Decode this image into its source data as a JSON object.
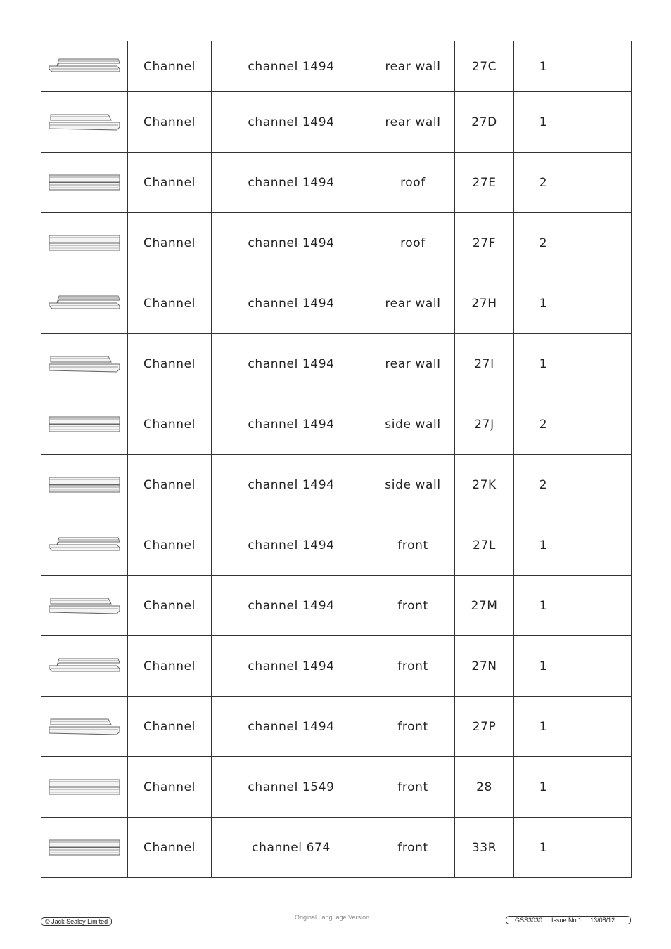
{
  "rows": [
    {
      "thumb": "channel-offset-up-icon",
      "type": "Channel",
      "part": "channel 1494",
      "location": "rear wall",
      "ref": "27C",
      "qty": "1",
      "notes": ""
    },
    {
      "thumb": "channel-offset-down-icon",
      "type": "Channel",
      "part": "channel 1494",
      "location": "rear wall",
      "ref": "27D",
      "qty": "1",
      "notes": ""
    },
    {
      "thumb": "channel-stacked-icon",
      "type": "Channel",
      "part": "channel 1494",
      "location": "roof",
      "ref": "27E",
      "qty": "2",
      "notes": ""
    },
    {
      "thumb": "channel-stacked-icon",
      "type": "Channel",
      "part": "channel 1494",
      "location": "roof",
      "ref": "27F",
      "qty": "2",
      "notes": ""
    },
    {
      "thumb": "channel-offset-up-icon",
      "type": "Channel",
      "part": "channel 1494",
      "location": "rear wall",
      "ref": "27H",
      "qty": "1",
      "notes": ""
    },
    {
      "thumb": "channel-offset-down-icon",
      "type": "Channel",
      "part": "channel 1494",
      "location": "rear wall",
      "ref": "27I",
      "qty": "1",
      "notes": ""
    },
    {
      "thumb": "channel-stacked-icon",
      "type": "Channel",
      "part": "channel 1494",
      "location": "side wall",
      "ref": "27J",
      "qty": "2",
      "notes": ""
    },
    {
      "thumb": "channel-stacked-icon",
      "type": "Channel",
      "part": "channel 1494",
      "location": "side wall",
      "ref": "27K",
      "qty": "2",
      "notes": ""
    },
    {
      "thumb": "channel-offset-up-icon",
      "type": "Channel",
      "part": "channel 1494",
      "location": "front",
      "ref": "27L",
      "qty": "1",
      "notes": ""
    },
    {
      "thumb": "channel-offset-down-icon",
      "type": "Channel",
      "part": "channel 1494",
      "location": "front",
      "ref": "27M",
      "qty": "1",
      "notes": ""
    },
    {
      "thumb": "channel-offset-up-icon",
      "type": "Channel",
      "part": "channel 1494",
      "location": "front",
      "ref": "27N",
      "qty": "1",
      "notes": ""
    },
    {
      "thumb": "channel-offset-down-icon",
      "type": "Channel",
      "part": "channel 1494",
      "location": "front",
      "ref": "27P",
      "qty": "1",
      "notes": ""
    },
    {
      "thumb": "channel-stacked-icon",
      "type": "Channel",
      "part": "channel 1549",
      "location": "front",
      "ref": "28",
      "qty": "1",
      "notes": ""
    },
    {
      "thumb": "channel-stacked-icon",
      "type": "Channel",
      "part": "channel 674",
      "location": "front",
      "ref": "33R",
      "qty": "1",
      "notes": ""
    }
  ],
  "footer": {
    "copyright": "© Jack Sealey Limited",
    "language": "Original Language Version",
    "doc_code": "GSS3030",
    "issue": "Issue No.1",
    "date": "13/08/12"
  }
}
